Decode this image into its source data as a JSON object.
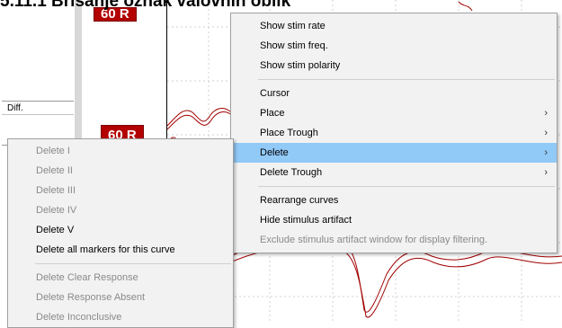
{
  "heading": "5.11.1 Brisanje oznak valovnih oblik",
  "left_table": {
    "header": "Diff."
  },
  "markers": {
    "top": "60 R",
    "mid": "60 R"
  },
  "context_menu": {
    "items": [
      {
        "label": "Show stim rate"
      },
      {
        "label": "Show stim freq."
      },
      {
        "label": "Show stim polarity"
      },
      {
        "label": "Cursor"
      },
      {
        "label": "Place",
        "submenu_arrow": "›"
      },
      {
        "label": "Place Trough",
        "submenu_arrow": "›"
      },
      {
        "label": "Delete",
        "submenu_arrow": "›"
      },
      {
        "label": "Delete Trough",
        "submenu_arrow": "›"
      },
      {
        "label": "Rearrange curves"
      },
      {
        "label": "Hide stimulus artifact"
      },
      {
        "label": "Exclude stimulus artifact window for display filtering."
      }
    ]
  },
  "submenu": {
    "items": [
      {
        "label": "Delete I"
      },
      {
        "label": "Delete II"
      },
      {
        "label": "Delete III"
      },
      {
        "label": "Delete IV"
      },
      {
        "label": "Delete V"
      },
      {
        "label": "Delete all markers for this curve"
      },
      {
        "label": "Delete Clear Response"
      },
      {
        "label": "Delete Response Absent"
      },
      {
        "label": "Delete Inconclusive"
      }
    ]
  },
  "colors": {
    "highlight": "#91c9f7",
    "trace": "#a10000",
    "marker": "#b30000"
  }
}
